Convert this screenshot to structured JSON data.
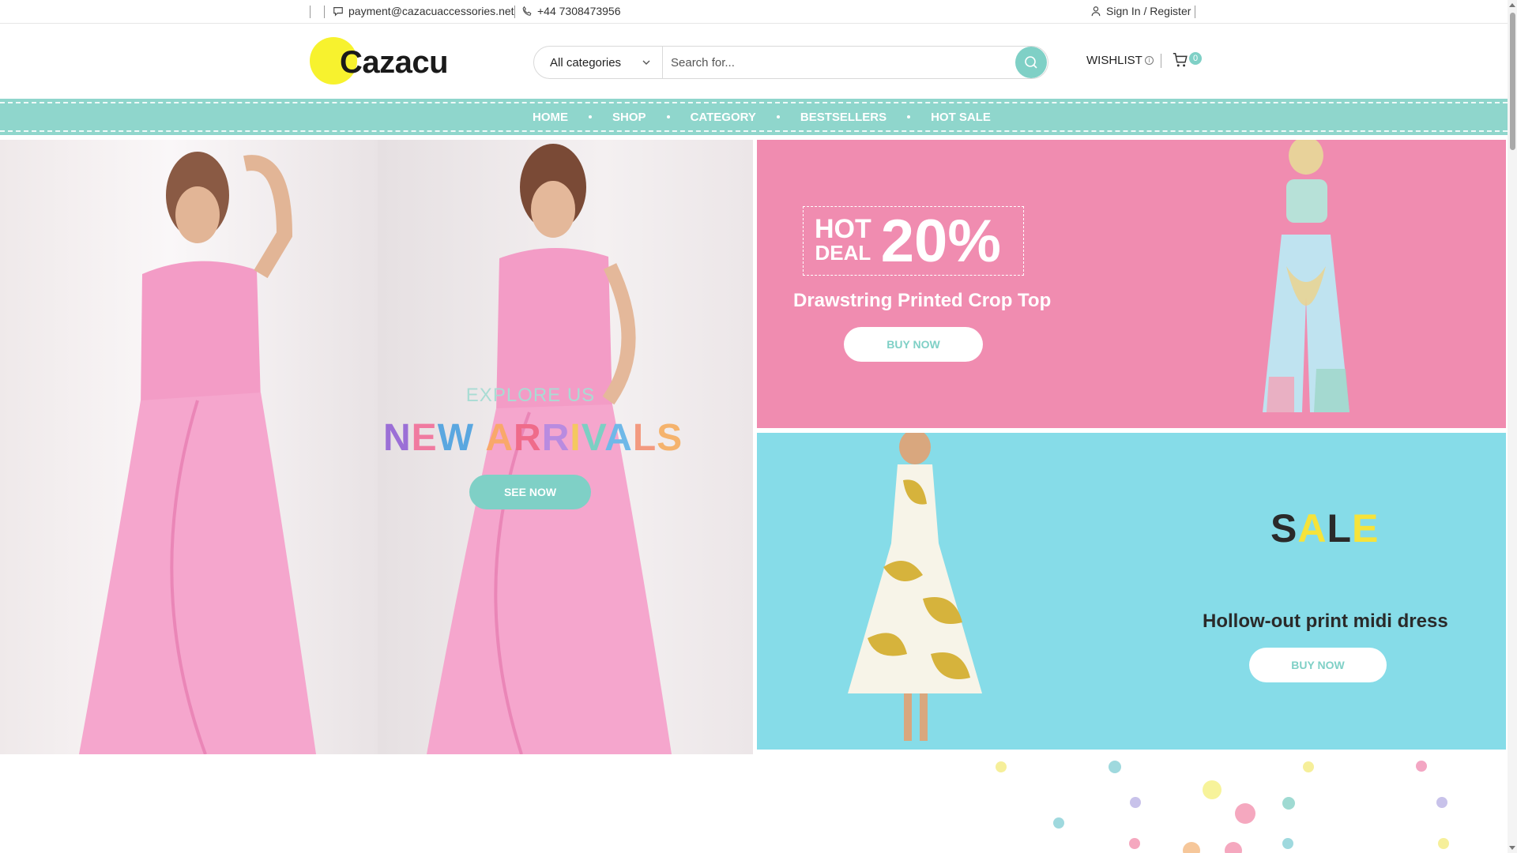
{
  "topbar": {
    "email": "payment@cazacuaccessories.net",
    "phone": "+44 7308473956",
    "signin": "Sign In / Register"
  },
  "header": {
    "logo_text": "Cazacu",
    "category_select": "All categories",
    "search_placeholder": "Search for...",
    "wishlist": "WISHLIST",
    "cart_count": "0"
  },
  "nav": {
    "items": [
      {
        "label": "HOME"
      },
      {
        "label": "SHOP"
      },
      {
        "label": "CATEGORY"
      },
      {
        "label": "BESTSELLERS"
      },
      {
        "label": "HOT SALE"
      }
    ]
  },
  "hero_left": {
    "eyebrow": "EXPLORE US",
    "headline_letters": [
      "N",
      "E",
      "W",
      " ",
      "A",
      "R",
      "R",
      "I",
      "V",
      "A",
      "L",
      "S"
    ],
    "headline": "NEW ARRIVALS",
    "cta": "SEE NOW"
  },
  "promo_top": {
    "badge_line1": "HOT",
    "badge_line2": "DEAL",
    "discount": "20%",
    "title": "Drawstring Printed Crop Top",
    "cta": "BUY NOW"
  },
  "promo_bottom": {
    "sale_letters": [
      "S",
      "A",
      "L",
      "E"
    ],
    "title": "Hollow-out print midi dress",
    "cta": "BUY NOW"
  },
  "colors": {
    "accent": "#7fd0c6",
    "nav_bg": "#8fd6cc",
    "pink_promo": "#f08cb0",
    "blue_promo": "#86dce8",
    "logo_yellow": "#f7f22e"
  },
  "icons": {
    "email": "message-icon",
    "phone": "phone-icon",
    "user": "user-icon",
    "search": "search-icon",
    "cart": "cart-icon",
    "dropdown": "chevron-down-icon"
  }
}
